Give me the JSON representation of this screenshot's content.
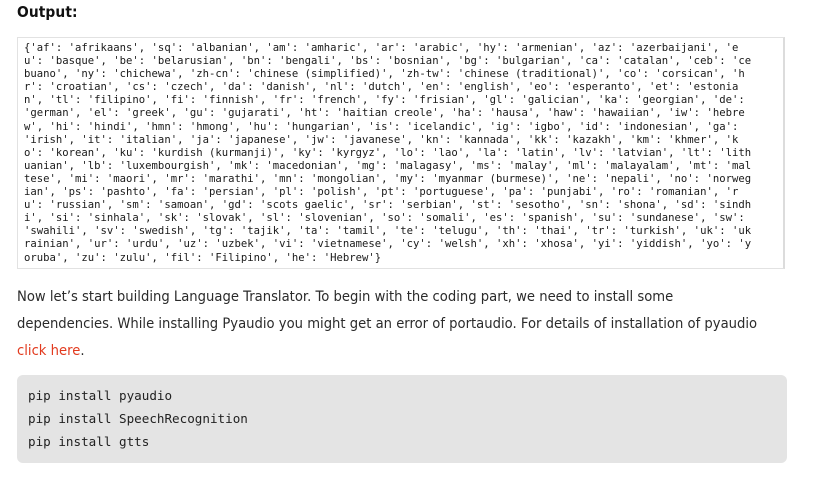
{
  "output_heading": "Output:",
  "output_lines": [
    "{'af': 'afrikaans', 'sq': 'albanian', 'am': 'amharic', 'ar': 'arabic', 'hy': 'armenian', 'az': 'azerbaijani', 'e",
    "u': 'basque', 'be': 'belarusian', 'bn': 'bengali', 'bs': 'bosnian', 'bg': 'bulgarian', 'ca': 'catalan', 'ceb': 'ce",
    "buano', 'ny': 'chichewa', 'zh-cn': 'chinese (simplified)', 'zh-tw': 'chinese (traditional)', 'co': 'corsican', 'h",
    "r': 'croatian', 'cs': 'czech', 'da': 'danish', 'nl': 'dutch', 'en': 'english', 'eo': 'esperanto', 'et': 'estonia",
    "n', 'tl': 'filipino', 'fi': 'finnish', 'fr': 'french', 'fy': 'frisian', 'gl': 'galician', 'ka': 'georgian', 'de':",
    "'german', 'el': 'greek', 'gu': 'gujarati', 'ht': 'haitian creole', 'ha': 'hausa', 'haw': 'hawaiian', 'iw': 'hebre",
    "w', 'hi': 'hindi', 'hmn': 'hmong', 'hu': 'hungarian', 'is': 'icelandic', 'ig': 'igbo', 'id': 'indonesian', 'ga':",
    "'irish', 'it': 'italian', 'ja': 'japanese', 'jw': 'javanese', 'kn': 'kannada', 'kk': 'kazakh', 'km': 'khmer', 'k",
    "o': 'korean', 'ku': 'kurdish (kurmanji)', 'ky': 'kyrgyz', 'lo': 'lao', 'la': 'latin', 'lv': 'latvian', 'lt': 'lith",
    "uanian', 'lb': 'luxembourgish', 'mk': 'macedonian', 'mg': 'malagasy', 'ms': 'malay', 'ml': 'malayalam', 'mt': 'mal",
    "tese', 'mi': 'maori', 'mr': 'marathi', 'mn': 'mongolian', 'my': 'myanmar (burmese)', 'ne': 'nepali', 'no': 'norweg",
    "ian', 'ps': 'pashto', 'fa': 'persian', 'pl': 'polish', 'pt': 'portuguese', 'pa': 'punjabi', 'ro': 'romanian', 'r",
    "u': 'russian', 'sm': 'samoan', 'gd': 'scots gaelic', 'sr': 'serbian', 'st': 'sesotho', 'sn': 'shona', 'sd': 'sindh",
    "i', 'si': 'sinhala', 'sk': 'slovak', 'sl': 'slovenian', 'so': 'somali', 'es': 'spanish', 'su': 'sundanese', 'sw':",
    "'swahili', 'sv': 'swedish', 'tg': 'tajik', 'ta': 'tamil', 'te': 'telugu', 'th': 'thai', 'tr': 'turkish', 'uk': 'uk",
    "rainian', 'ur': 'urdu', 'uz': 'uzbek', 'vi': 'vietnamese', 'cy': 'welsh', 'xh': 'xhosa', 'yi': 'yiddish', 'yo': 'y",
    "oruba', 'zu': 'zulu', 'fil': 'Filipino', 'he': 'Hebrew'}"
  ],
  "paragraph": {
    "text_before_link": "Now let’s start building Language Translator. To begin with the coding part, we need to install some dependencies. While installing Pyaudio you might get an error of portaudio. For details of installation of pyaudio ",
    "link_text": "click here",
    "text_after_link": "."
  },
  "code": {
    "lines": [
      "pip install pyaudio",
      "pip install SpeechRecognition",
      "pip install gtts"
    ]
  },
  "colors": {
    "link": "#e23a1e",
    "code_background": "#e4e4e4"
  }
}
